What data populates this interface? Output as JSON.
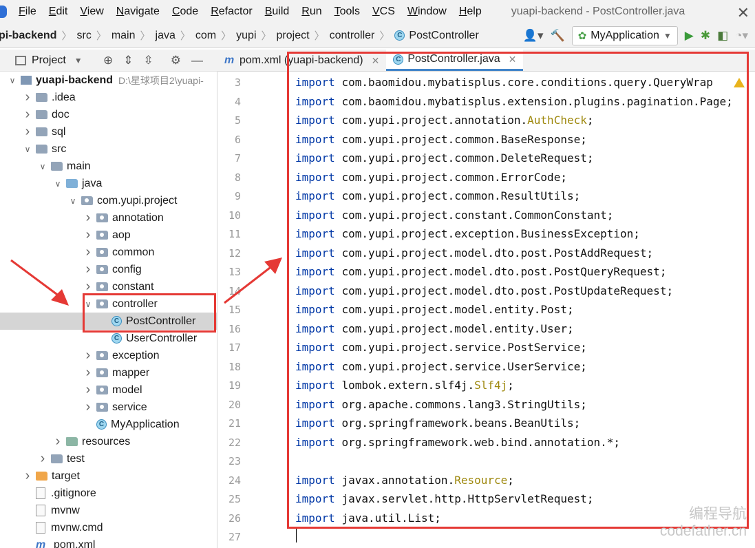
{
  "menubar": {
    "items": [
      "File",
      "Edit",
      "View",
      "Navigate",
      "Code",
      "Refactor",
      "Build",
      "Run",
      "Tools",
      "VCS",
      "Window",
      "Help"
    ],
    "window_title": "yuapi-backend - PostController.java"
  },
  "breadcrumb": [
    "pi-backend",
    "src",
    "main",
    "java",
    "com",
    "yupi",
    "project",
    "controller",
    "PostController"
  ],
  "run_config": {
    "name": "MyApplication"
  },
  "project_panel": {
    "title": "Project"
  },
  "tree": [
    {
      "label": "yuapi-backend",
      "path": "D:\\星球项目2\\yuapi-",
      "depth": 1,
      "arrow": "v",
      "icon": "module",
      "bold": true
    },
    {
      "label": ".idea",
      "depth": 2,
      "arrow": ">",
      "icon": "folder"
    },
    {
      "label": "doc",
      "depth": 2,
      "arrow": ">",
      "icon": "folder"
    },
    {
      "label": "sql",
      "depth": 2,
      "arrow": ">",
      "icon": "folder"
    },
    {
      "label": "src",
      "depth": 2,
      "arrow": "v",
      "icon": "folder"
    },
    {
      "label": "main",
      "depth": 3,
      "arrow": "v",
      "icon": "folder"
    },
    {
      "label": "java",
      "depth": 4,
      "arrow": "v",
      "icon": "src"
    },
    {
      "label": "com.yupi.project",
      "depth": 5,
      "arrow": "v",
      "icon": "pkg"
    },
    {
      "label": "annotation",
      "depth": 6,
      "arrow": ">",
      "icon": "pkg"
    },
    {
      "label": "aop",
      "depth": 6,
      "arrow": ">",
      "icon": "pkg"
    },
    {
      "label": "common",
      "depth": 6,
      "arrow": ">",
      "icon": "pkg"
    },
    {
      "label": "config",
      "depth": 6,
      "arrow": ">",
      "icon": "pkg"
    },
    {
      "label": "constant",
      "depth": 6,
      "arrow": ">",
      "icon": "pkg"
    },
    {
      "label": "controller",
      "depth": 6,
      "arrow": "v",
      "icon": "pkg"
    },
    {
      "label": "PostController",
      "depth": 7,
      "arrow": "",
      "icon": "class",
      "selected": true
    },
    {
      "label": "UserController",
      "depth": 7,
      "arrow": "",
      "icon": "class"
    },
    {
      "label": "exception",
      "depth": 6,
      "arrow": ">",
      "icon": "pkg"
    },
    {
      "label": "mapper",
      "depth": 6,
      "arrow": ">",
      "icon": "pkg"
    },
    {
      "label": "model",
      "depth": 6,
      "arrow": ">",
      "icon": "pkg"
    },
    {
      "label": "service",
      "depth": 6,
      "arrow": ">",
      "icon": "pkg"
    },
    {
      "label": "MyApplication",
      "depth": 6,
      "arrow": "",
      "icon": "class"
    },
    {
      "label": "resources",
      "depth": 4,
      "arrow": ">",
      "icon": "res"
    },
    {
      "label": "test",
      "depth": 3,
      "arrow": ">",
      "icon": "folder"
    },
    {
      "label": "target",
      "depth": 2,
      "arrow": ">",
      "icon": "orange"
    },
    {
      "label": ".gitignore",
      "depth": 2,
      "arrow": "",
      "icon": "file"
    },
    {
      "label": "mvnw",
      "depth": 2,
      "arrow": "",
      "icon": "file"
    },
    {
      "label": "mvnw.cmd",
      "depth": 2,
      "arrow": "",
      "icon": "file"
    },
    {
      "label": "pom.xml",
      "depth": 2,
      "arrow": "",
      "icon": "m"
    }
  ],
  "tabs": [
    {
      "label": "pom.xml (yuapi-backend)",
      "icon": "m",
      "active": false
    },
    {
      "label": "PostController.java",
      "icon": "class",
      "active": true
    }
  ],
  "code": {
    "lines": [
      {
        "num": "3",
        "kw": "import",
        "rest": "com.baomidou.mybatisplus.core.conditions.query.QueryWrap"
      },
      {
        "num": "4",
        "kw": "import",
        "rest": "com.baomidou.mybatisplus.extension.plugins.pagination.Page;"
      },
      {
        "num": "5",
        "kw": "import",
        "rest": "com.yupi.project.annotation.",
        "anno": "AuthCheck",
        "tail": ";"
      },
      {
        "num": "6",
        "kw": "import",
        "rest": "com.yupi.project.common.BaseResponse;"
      },
      {
        "num": "7",
        "kw": "import",
        "rest": "com.yupi.project.common.DeleteRequest;"
      },
      {
        "num": "8",
        "kw": "import",
        "rest": "com.yupi.project.common.ErrorCode;"
      },
      {
        "num": "9",
        "kw": "import",
        "rest": "com.yupi.project.common.ResultUtils;"
      },
      {
        "num": "10",
        "kw": "import",
        "rest": "com.yupi.project.constant.CommonConstant;"
      },
      {
        "num": "11",
        "kw": "import",
        "rest": "com.yupi.project.exception.BusinessException;"
      },
      {
        "num": "12",
        "kw": "import",
        "rest": "com.yupi.project.model.dto.post.PostAddRequest;"
      },
      {
        "num": "13",
        "kw": "import",
        "rest": "com.yupi.project.model.dto.post.PostQueryRequest;"
      },
      {
        "num": "14",
        "kw": "import",
        "rest": "com.yupi.project.model.dto.post.PostUpdateRequest;"
      },
      {
        "num": "15",
        "kw": "import",
        "rest": "com.yupi.project.model.entity.Post;"
      },
      {
        "num": "16",
        "kw": "import",
        "rest": "com.yupi.project.model.entity.User;"
      },
      {
        "num": "17",
        "kw": "import",
        "rest": "com.yupi.project.service.PostService;"
      },
      {
        "num": "18",
        "kw": "import",
        "rest": "com.yupi.project.service.UserService;"
      },
      {
        "num": "19",
        "kw": "import",
        "rest": "lombok.extern.slf4j.",
        "anno": "Slf4j",
        "tail": ";"
      },
      {
        "num": "20",
        "kw": "import",
        "rest": "org.apache.commons.lang3.StringUtils;"
      },
      {
        "num": "21",
        "kw": "import",
        "rest": "org.springframework.beans.BeanUtils;"
      },
      {
        "num": "22",
        "kw": "import",
        "rest": "org.springframework.web.bind.annotation.*;"
      },
      {
        "num": "23",
        "kw": "",
        "rest": ""
      },
      {
        "num": "24",
        "kw": "import",
        "rest": "javax.annotation.",
        "anno": "Resource",
        "tail": ";"
      },
      {
        "num": "25",
        "kw": "import",
        "rest": "javax.servlet.http.HttpServletRequest;"
      },
      {
        "num": "26",
        "kw": "import",
        "rest": "java.util.List;"
      },
      {
        "num": "27",
        "kw": "",
        "rest": ""
      }
    ]
  },
  "watermark": {
    "line1": "编程导航",
    "line2": "codefather.cn"
  },
  "colors": {
    "highlight": "#e53935",
    "keyword": "#0037a6",
    "annotation": "#9e880d",
    "selection": "#d5d5d5",
    "tab_underline": "#4083c9"
  }
}
